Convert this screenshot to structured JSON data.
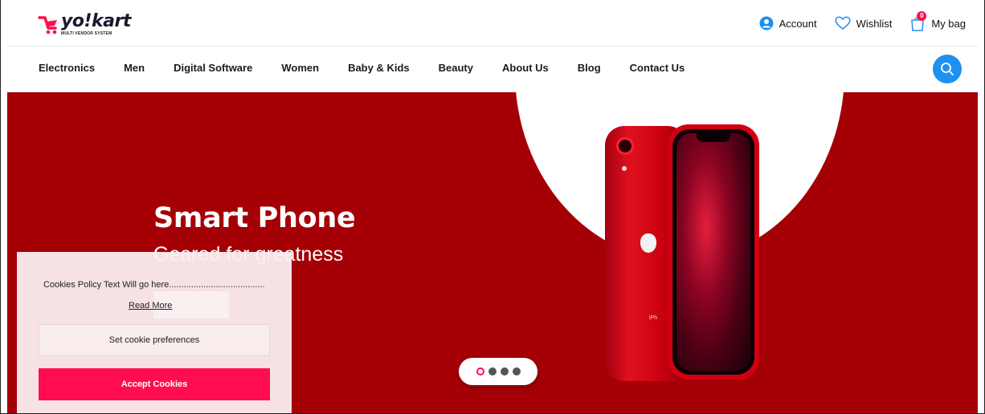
{
  "brand": {
    "name": "yo!kart",
    "tagline": "MULTI VENDOR SYSTEM",
    "accent_color": "#ff0d4d"
  },
  "header": {
    "account_label": "Account",
    "wishlist_label": "Wishlist",
    "bag_label": "My bag",
    "bag_count": "0",
    "icons": {
      "account": "user-circle-icon",
      "wishlist": "heart-icon",
      "bag": "shopping-bag-icon"
    }
  },
  "nav": {
    "items": [
      {
        "label": "Electronics"
      },
      {
        "label": "Men"
      },
      {
        "label": "Digital Software"
      },
      {
        "label": "Women"
      },
      {
        "label": "Baby & Kids"
      },
      {
        "label": "Beauty"
      },
      {
        "label": "About Us"
      },
      {
        "label": "Blog"
      },
      {
        "label": "Contact Us"
      }
    ],
    "search_icon": "search-icon",
    "search_color": "#1e90f0"
  },
  "hero": {
    "title": "Smart Phone",
    "subtitle": "Geared for greatness",
    "background_color": "#a50006",
    "slide_count": 4,
    "active_slide": 0
  },
  "cookie": {
    "text": "Cookies Policy Text Will go here.......................................",
    "read_more": "Read More",
    "preferences_label": "Set cookie preferences",
    "accept_label": "Accept Cookies"
  }
}
